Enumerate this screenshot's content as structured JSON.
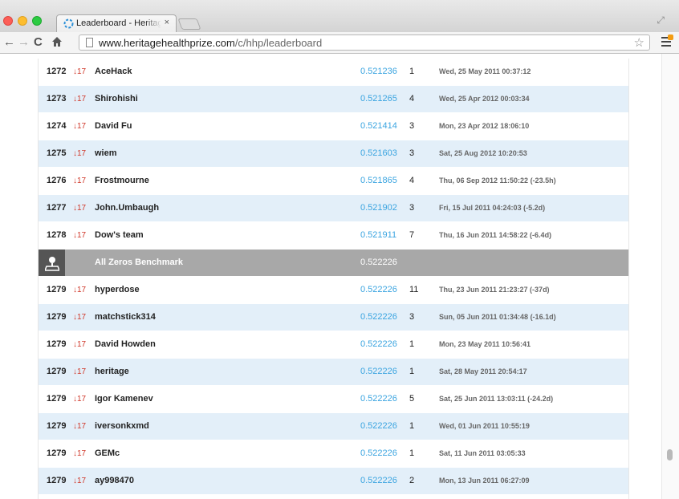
{
  "browser": {
    "tab_title": "Leaderboard - Heritage Health Prize",
    "tab_close": "×",
    "url_host": "www.heritagehealthprize.com",
    "url_path": "/c/hhp/leaderboard"
  },
  "leaderboard": {
    "rows_before": [
      {
        "rank": "1272",
        "delta": "↓17",
        "team": "AceHack",
        "score": "0.521236",
        "entries": "1",
        "last": "Wed, 25 May 2011 00:37:12"
      },
      {
        "rank": "1273",
        "delta": "↓17",
        "team": "Shirohishi",
        "score": "0.521265",
        "entries": "4",
        "last": "Wed, 25 Apr 2012 00:03:34"
      },
      {
        "rank": "1274",
        "delta": "↓17",
        "team": "David Fu",
        "score": "0.521414",
        "entries": "3",
        "last": "Mon, 23 Apr 2012 18:06:10"
      },
      {
        "rank": "1275",
        "delta": "↓17",
        "team": "wiem",
        "score": "0.521603",
        "entries": "3",
        "last": "Sat, 25 Aug 2012 10:20:53"
      },
      {
        "rank": "1276",
        "delta": "↓17",
        "team": "Frostmourne",
        "score": "0.521865",
        "entries": "4",
        "last": "Thu, 06 Sep 2012 11:50:22 (-23.5h)"
      },
      {
        "rank": "1277",
        "delta": "↓17",
        "team": "John.Umbaugh",
        "score": "0.521902",
        "entries": "3",
        "last": "Fri, 15 Jul 2011 04:24:03 (-5.2d)"
      },
      {
        "rank": "1278",
        "delta": "↓17",
        "team": "Dow's team",
        "score": "0.521911",
        "entries": "7",
        "last": "Thu, 16 Jun 2011 14:58:22 (-6.4d)"
      }
    ],
    "benchmark": {
      "name": "All Zeros Benchmark",
      "score": "0.522226"
    },
    "rows_after": [
      {
        "rank": "1279",
        "delta": "↓17",
        "team": "hyperdose",
        "score": "0.522226",
        "entries": "11",
        "last": "Thu, 23 Jun 2011 21:23:27 (-37d)"
      },
      {
        "rank": "1279",
        "delta": "↓17",
        "team": "matchstick314",
        "score": "0.522226",
        "entries": "3",
        "last": "Sun, 05 Jun 2011 01:34:48 (-16.1d)"
      },
      {
        "rank": "1279",
        "delta": "↓17",
        "team": "David Howden",
        "score": "0.522226",
        "entries": "1",
        "last": "Mon, 23 May 2011 10:56:41"
      },
      {
        "rank": "1279",
        "delta": "↓17",
        "team": "heritage",
        "score": "0.522226",
        "entries": "1",
        "last": "Sat, 28 May 2011 20:54:17"
      },
      {
        "rank": "1279",
        "delta": "↓17",
        "team": "Igor Kamenev",
        "score": "0.522226",
        "entries": "5",
        "last": "Sat, 25 Jun 2011 13:03:11 (-24.2d)"
      },
      {
        "rank": "1279",
        "delta": "↓17",
        "team": "iversonkxmd",
        "score": "0.522226",
        "entries": "1",
        "last": "Wed, 01 Jun 2011 10:55:19"
      },
      {
        "rank": "1279",
        "delta": "↓17",
        "team": "GEMc",
        "score": "0.522226",
        "entries": "1",
        "last": "Sat, 11 Jun 2011 03:05:33"
      },
      {
        "rank": "1279",
        "delta": "↓17",
        "team": "ay998470",
        "score": "0.522226",
        "entries": "2",
        "last": "Mon, 13 Jun 2011 06:27:09"
      }
    ]
  },
  "colors": {
    "score": "#3aa4e0",
    "delta": "#d0392b",
    "alt_row": "#e3eff9",
    "benchmark_row": "#a8a8a8"
  },
  "icons": {
    "benchmark": "map-marker-icon",
    "tab": "kaggle-favicon-icon"
  }
}
